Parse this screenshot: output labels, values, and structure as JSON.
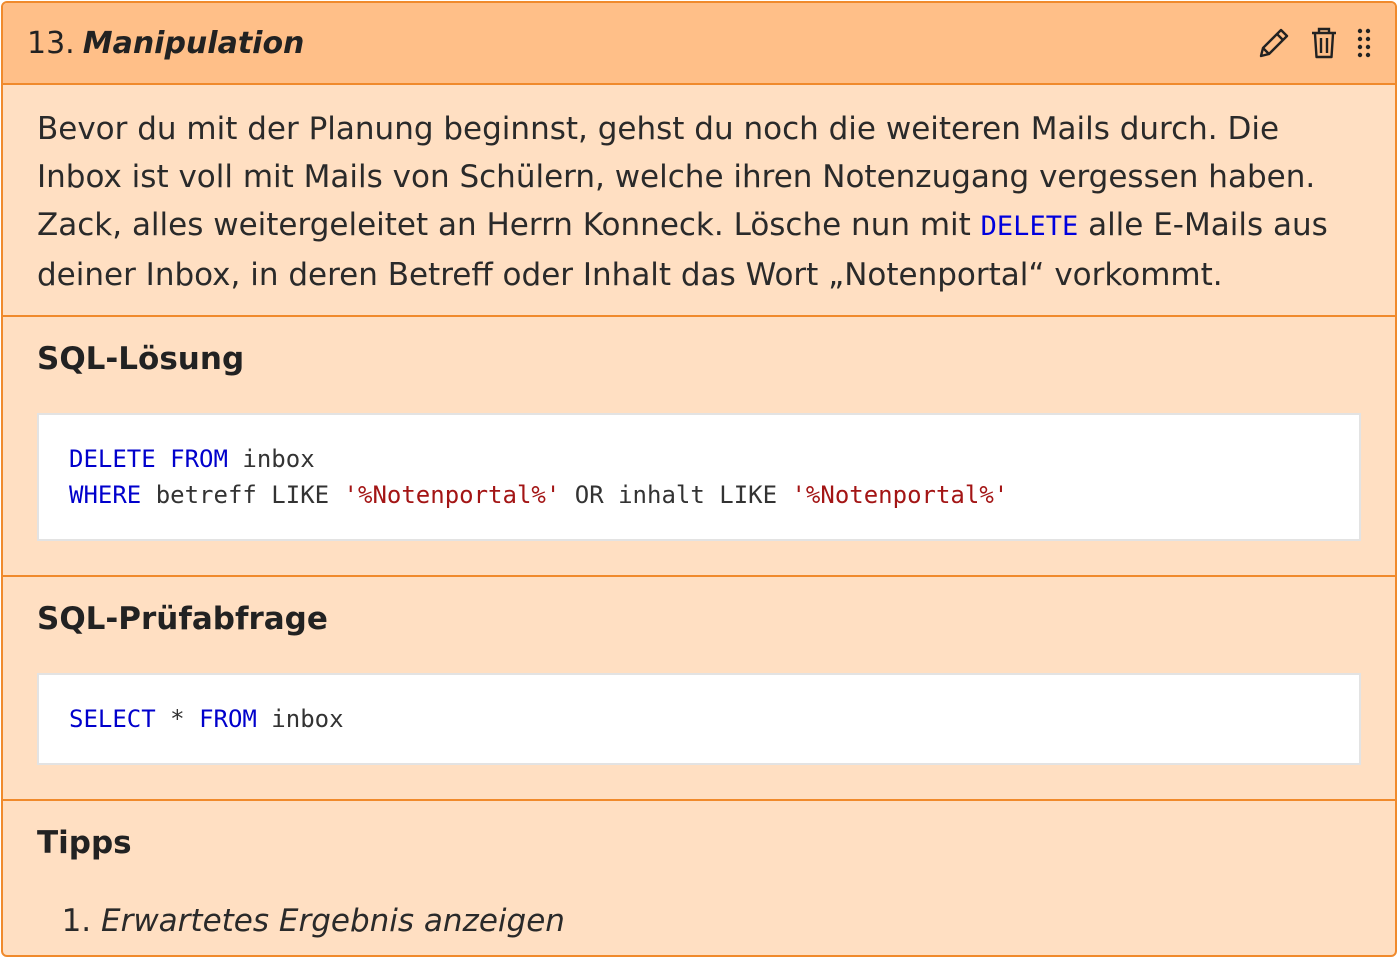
{
  "header": {
    "number": "13.",
    "title": "Manipulation",
    "actions": [
      {
        "icon": "pencil-icon",
        "label": "edit"
      },
      {
        "icon": "trash-icon",
        "label": "delete"
      },
      {
        "icon": "drag-handle-icon",
        "label": "drag"
      }
    ]
  },
  "intro": {
    "text_before": "Bevor du mit der Planung beginnst, gehst du noch die weiteren Mails durch. Die Inbox ist voll mit Mails von Schülern, welche ihren Notenzugang vergessen haben. Zack, alles weitergeleitet an Herrn Konneck. Lösche nun mit ",
    "keyword": "DELETE",
    "text_after": " alle E-Mails aus deiner Inbox, in deren Betreff oder Inhalt das Wort „Notenportal“ vorkommt."
  },
  "solution": {
    "title": "SQL-Lösung",
    "line1": {
      "k1": "DELETE",
      "k2": "FROM",
      "rest": "inbox"
    },
    "line2": {
      "k1": "WHERE",
      "t1": "betreff LIKE ",
      "s1": "'%Notenportal%'",
      "t2": " OR inhalt LIKE ",
      "s2": "'%Notenportal%'"
    }
  },
  "check": {
    "title": "SQL-Prüfabfrage",
    "line1": {
      "k1": "SELECT",
      "t1": " * ",
      "k2": "FROM",
      "rest": " inbox"
    }
  },
  "tips": {
    "title": "Tipps",
    "items": [
      "Erwartetes Ergebnis anzeigen"
    ]
  },
  "colors": {
    "border": "#f08a2c",
    "header_bg": "#ffbf88",
    "body_bg": "#ffdfc2",
    "keyword": "#0000cc",
    "string": "#a31515"
  }
}
